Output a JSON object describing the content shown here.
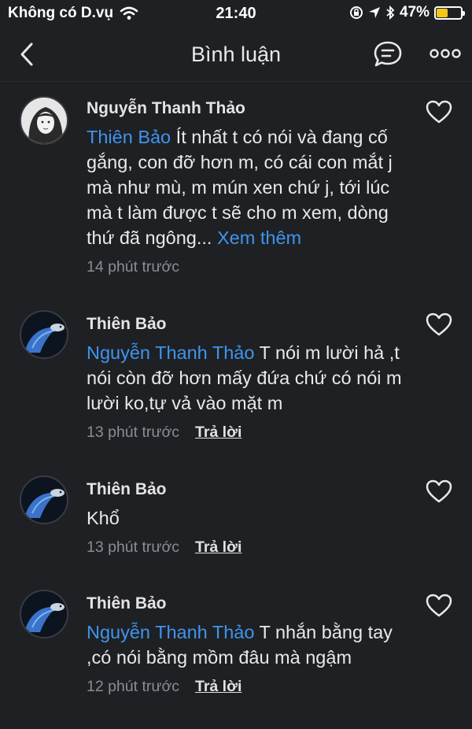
{
  "status_bar": {
    "carrier": "Không có D.vụ",
    "time": "21:40",
    "battery": "47%",
    "battery_level": 0.47,
    "battery_color": "#f5c518"
  },
  "nav": {
    "title": "Bình luận",
    "back_icon": "chevron-left-icon",
    "chat_icon": "chat-bubble-icon",
    "more_icon": "more-horizontal-icon"
  },
  "colors": {
    "background": "#1f2023",
    "mention": "#3d95f0",
    "meta": "#8c8d93"
  },
  "comments": [
    {
      "author": "Nguyễn Thanh Thảo",
      "mention": "Thiên Bảo",
      "text": " Ít nhất t có nói và đang cố gắng, con đỡ hơn m, có cái con mắt j mà như mù, m mún xen chứ j, tới lúc mà t làm được t sẽ cho m xem, dòng thứ đã ngông... ",
      "more": "Xem thêm",
      "time": "14 phút trước",
      "reply": ""
    },
    {
      "author": "Thiên Bảo",
      "mention": "Nguyễn Thanh Thảo",
      "text": " T nói m lười hả ,t nói còn đỡ hơn mấy đứa chứ có nói m lười ko,tự vả vào mặt m",
      "time": "13 phút trước",
      "reply": "Trả lời"
    },
    {
      "author": "Thiên Bảo",
      "mention": "",
      "text": "Khổ",
      "time": "13 phút trước",
      "reply": "Trả lời"
    },
    {
      "author": "Thiên Bảo",
      "mention": "Nguyễn Thanh Thảo",
      "text": " T nhắn bằng tay ,có nói bằng mồm đâu mà ngậm",
      "time": "12 phút trước",
      "reply": "Trả lời"
    }
  ]
}
